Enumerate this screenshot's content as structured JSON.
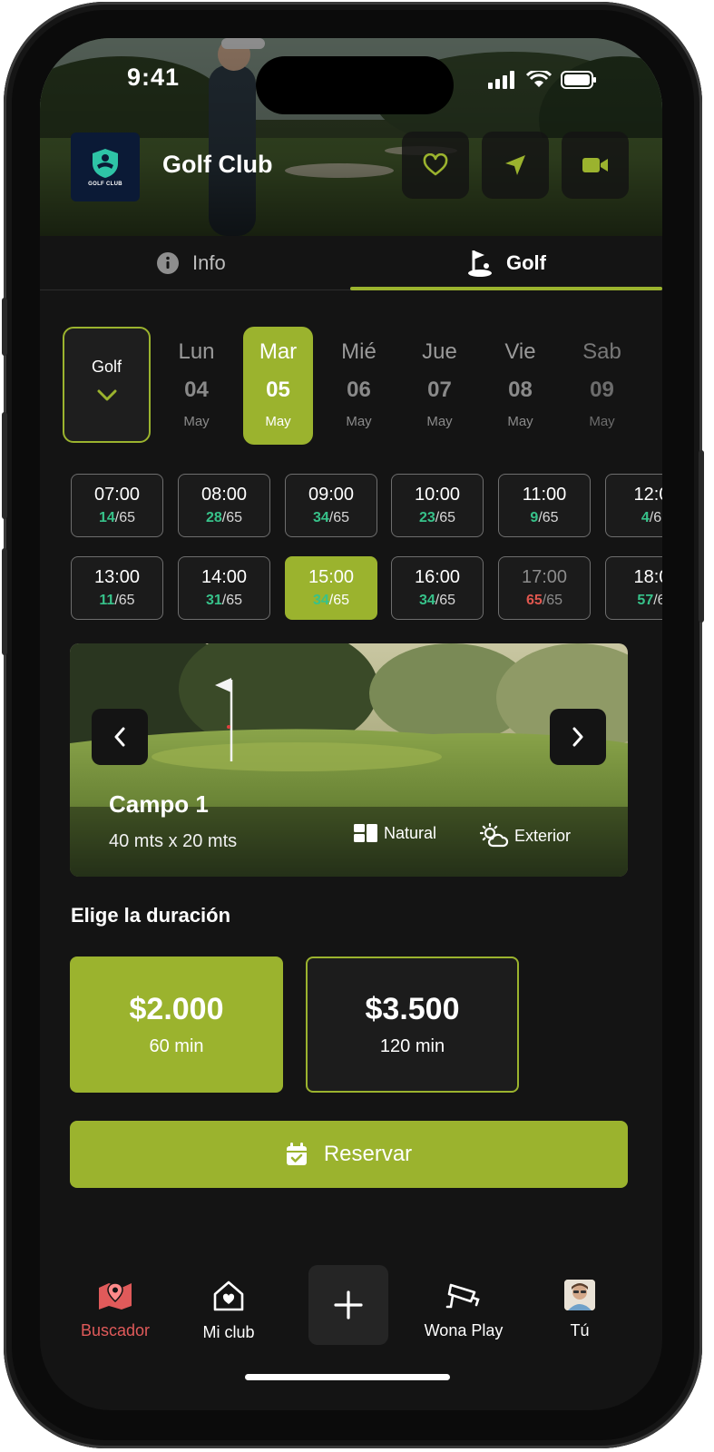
{
  "status": {
    "time": "9:41"
  },
  "header": {
    "club_name": "Golf Club",
    "logo_text": "GOLF CLUB",
    "buttons": [
      {
        "icon": "heart-icon"
      },
      {
        "icon": "navigation-arrow-icon"
      },
      {
        "icon": "video-camera-icon"
      }
    ]
  },
  "tabs": [
    {
      "label": "Info",
      "icon": "info-icon",
      "active": false
    },
    {
      "label": "Golf",
      "icon": "golf-flag-icon",
      "active": true
    }
  ],
  "sport_selector": {
    "label": "Golf"
  },
  "days": [
    {
      "name": "Lun",
      "date": "04",
      "month": "May",
      "selected": false
    },
    {
      "name": "Mar",
      "date": "05",
      "month": "May",
      "selected": true
    },
    {
      "name": "Mié",
      "date": "06",
      "month": "May",
      "selected": false
    },
    {
      "name": "Jue",
      "date": "07",
      "month": "May",
      "selected": false
    },
    {
      "name": "Vie",
      "date": "08",
      "month": "May",
      "selected": false
    },
    {
      "name": "Sab",
      "date": "09",
      "month": "May",
      "selected": false
    }
  ],
  "slots_row1": [
    {
      "time": "07:00",
      "taken": "14",
      "total": "/65"
    },
    {
      "time": "08:00",
      "taken": "28",
      "total": "/65"
    },
    {
      "time": "09:00",
      "taken": "34",
      "total": "/65"
    },
    {
      "time": "10:00",
      "taken": "23",
      "total": "/65"
    },
    {
      "time": "11:00",
      "taken": "9",
      "total": "/65"
    },
    {
      "time": "12:0",
      "taken": "4",
      "total": "/6"
    }
  ],
  "slots_row2": [
    {
      "time": "13:00",
      "taken": "11",
      "total": "/65"
    },
    {
      "time": "14:00",
      "taken": "31",
      "total": "/65"
    },
    {
      "time": "15:00",
      "taken": "34",
      "total": "/65",
      "selected": true
    },
    {
      "time": "16:00",
      "taken": "34",
      "total": "/65"
    },
    {
      "time": "17:00",
      "taken": "65",
      "total": "/65",
      "full": true
    },
    {
      "time": "18:0",
      "taken": "57",
      "total": "/6"
    }
  ],
  "field": {
    "name": "Campo 1",
    "size": "40 mts x 20 mts",
    "features": [
      {
        "icon": "grass-tiles-icon",
        "label": "Natural"
      },
      {
        "icon": "sun-cloud-icon",
        "label": "Exterior"
      }
    ]
  },
  "duration": {
    "title": "Elige la duración",
    "options": [
      {
        "price": "$2.000",
        "time": "60 min",
        "selected": true
      },
      {
        "price": "$3.500",
        "time": "120 min",
        "selected": false
      }
    ]
  },
  "reserve_label": "Reservar",
  "bottom_nav": [
    {
      "label": "Buscador",
      "icon": "map-pin-icon",
      "active": true
    },
    {
      "label": "Mi club",
      "icon": "house-heart-icon",
      "active": false
    },
    {
      "label": "Wona Play",
      "icon": "security-camera-icon",
      "active": false
    },
    {
      "label": "Tú",
      "icon": "avatar",
      "active": false
    }
  ],
  "colors": {
    "accent": "#9bb32e",
    "background": "#141414",
    "available": "#37c28a",
    "full": "#e0574f",
    "active_nav": "#e05a5a"
  }
}
